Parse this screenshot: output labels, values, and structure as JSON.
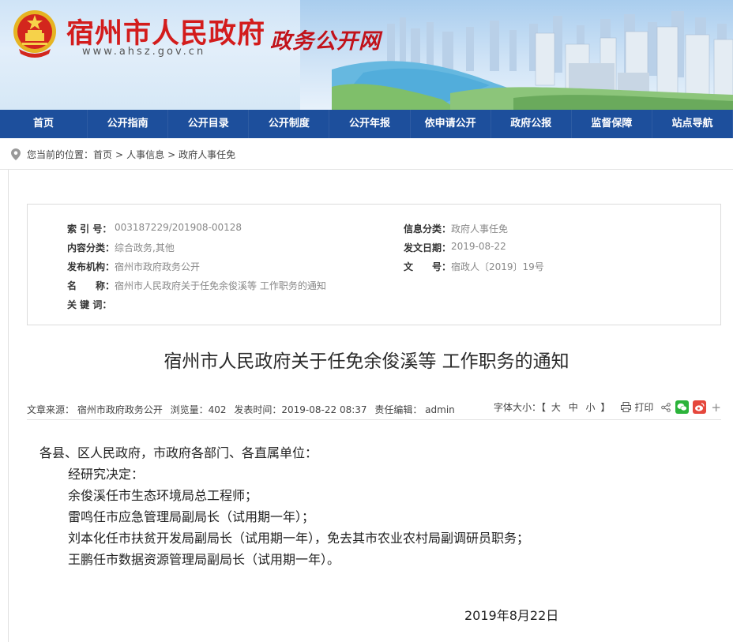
{
  "header": {
    "site_title": "宿州市人民政府",
    "site_url": "www.ahsz.gov.cn",
    "portal_name": "政务公开网"
  },
  "nav": {
    "items": [
      "首页",
      "公开指南",
      "公开目录",
      "公开制度",
      "公开年报",
      "依申请公开",
      "政府公报",
      "监督保障",
      "站点导航"
    ]
  },
  "breadcrumb": {
    "prefix": "您当前的位置：",
    "items": [
      "首页",
      "人事信息",
      "政府人事任免"
    ],
    "separator": ">"
  },
  "meta": {
    "index_label": "索 引 号：",
    "index_value": "003187229/201908-00128",
    "category_label": "信息分类：",
    "category_value": "政府人事任免",
    "content_label": "内容分类：",
    "content_value": "综合政务,其他",
    "date_label": "发文日期：",
    "date_value": "2019-08-22",
    "org_label": "发布机构：",
    "org_value": "宿州市政府政务公开",
    "docno_label": "文　　号：",
    "docno_value": "宿政人〔2019〕19号",
    "name_label": "名　　称：",
    "name_value": "宿州市人民政府关于任免余俊溪等 工作职务的通知",
    "keywords_label": "关 键 词：",
    "keywords_value": ""
  },
  "article": {
    "title": "宿州市人民政府关于任免余俊溪等 工作职务的通知",
    "source": "文章来源： 宿州市政府政务公开",
    "views": "浏览量：402",
    "publish_time": "发表时间：2019-08-22 08:37",
    "editor": "责任编辑： admin",
    "font_size_label": "字体大小：【",
    "font_big": "大",
    "font_mid": "中",
    "font_small": "小",
    "font_close": "】",
    "print_label": "打印",
    "plus": "+",
    "paragraphs": [
      "各县、区人民政府，市政府各部门、各直属单位：",
      "经研究决定：",
      "余俊溪任市生态环境局总工程师；",
      "雷鸣任市应急管理局副局长（试用期一年）；",
      "刘本化任市扶贫开发局副局长（试用期一年），免去其市农业农村局副调研员职务；",
      "王鹏任市数据资源管理局副局长（试用期一年）。"
    ],
    "date": "2019年8月22日"
  },
  "colors": {
    "nav_bg": "#1d4f9c",
    "title_red": "#d31c1c",
    "wechat": "#2bb33a",
    "weibo": "#e5473c"
  }
}
